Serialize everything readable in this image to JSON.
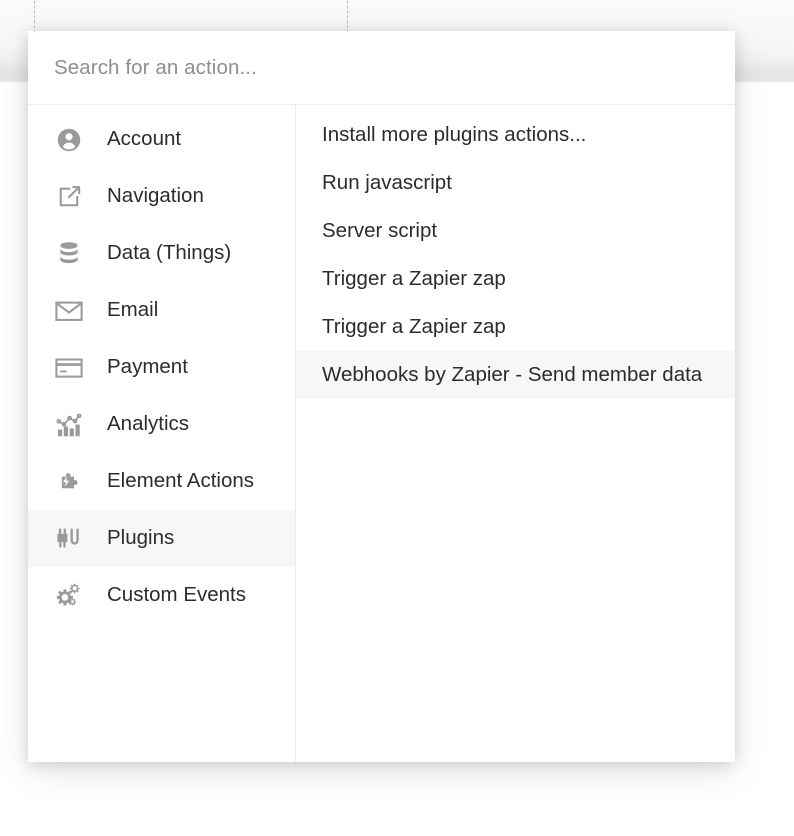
{
  "popup": {
    "search": {
      "placeholder": "Search for an action...",
      "value": ""
    },
    "categories": [
      {
        "label": "Account",
        "icon": "user-circle-icon",
        "selected": false
      },
      {
        "label": "Navigation",
        "icon": "external-link-icon",
        "selected": false
      },
      {
        "label": "Data (Things)",
        "icon": "database-icon",
        "selected": false
      },
      {
        "label": "Email",
        "icon": "envelope-icon",
        "selected": false
      },
      {
        "label": "Payment",
        "icon": "credit-card-icon",
        "selected": false
      },
      {
        "label": "Analytics",
        "icon": "bar-chart-icon",
        "selected": false
      },
      {
        "label": "Element Actions",
        "icon": "puzzle-bolt-icon",
        "selected": false
      },
      {
        "label": "Plugins",
        "icon": "plug-icon",
        "selected": true
      },
      {
        "label": "Custom Events",
        "icon": "gears-icon",
        "selected": false
      }
    ],
    "actions": [
      {
        "label": "Install more plugins actions...",
        "selected": false
      },
      {
        "label": "Run javascript",
        "selected": false
      },
      {
        "label": "Server script",
        "selected": false
      },
      {
        "label": "Trigger a Zapier zap",
        "selected": false
      },
      {
        "label": "Trigger a Zapier zap",
        "selected": false
      },
      {
        "label": "Webhooks by Zapier - Send member data",
        "selected": true
      }
    ]
  },
  "colors": {
    "panel_background": "#ffffff",
    "row_highlight": "#f7f7f7",
    "divider": "#ececec",
    "text_primary": "#2c2c2c",
    "text_placeholder": "#8f8f8f",
    "icon": "#9a9a9a",
    "dashed_border": "#b9bdbf"
  }
}
